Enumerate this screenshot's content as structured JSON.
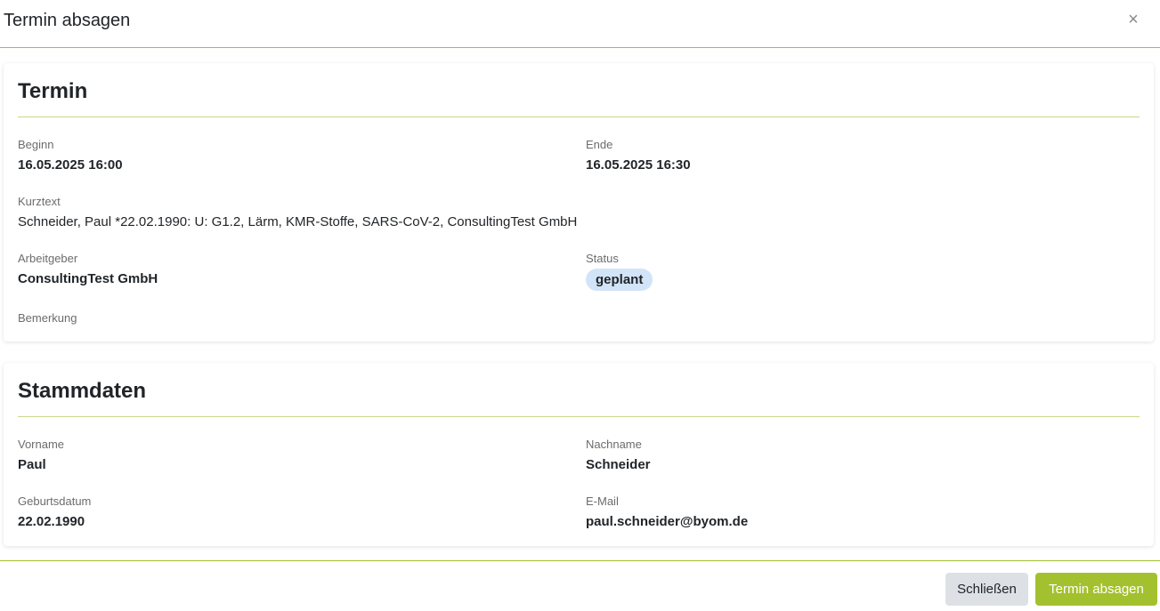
{
  "modal": {
    "title": "Termin absagen",
    "close_symbol": "×"
  },
  "termin": {
    "heading": "Termin",
    "beginn_label": "Beginn",
    "beginn_value": "16.05.2025 16:00",
    "ende_label": "Ende",
    "ende_value": "16.05.2025 16:30",
    "kurztext_label": "Kurztext",
    "kurztext_value": "Schneider, Paul *22.02.1990: U: G1.2, Lärm, KMR-Stoffe, SARS-CoV-2, ConsultingTest GmbH",
    "arbeitgeber_label": "Arbeitgeber",
    "arbeitgeber_value": "ConsultingTest GmbH",
    "status_label": "Status",
    "status_value": "geplant",
    "bemerkung_label": "Bemerkung"
  },
  "stammdaten": {
    "heading": "Stammdaten",
    "vorname_label": "Vorname",
    "vorname_value": "Paul",
    "nachname_label": "Nachname",
    "nachname_value": "Schneider",
    "geburtsdatum_label": "Geburtsdatum",
    "geburtsdatum_value": "22.02.1990",
    "email_label": "E-Mail",
    "email_value": "paul.schneider@byom.de"
  },
  "footer": {
    "close_label": "Schließen",
    "cancel_label": "Termin absagen"
  },
  "colors": {
    "accent": "#a3c12f",
    "status_badge_bg": "#d2e4f7",
    "secondary_button_bg": "#dde1e6"
  }
}
